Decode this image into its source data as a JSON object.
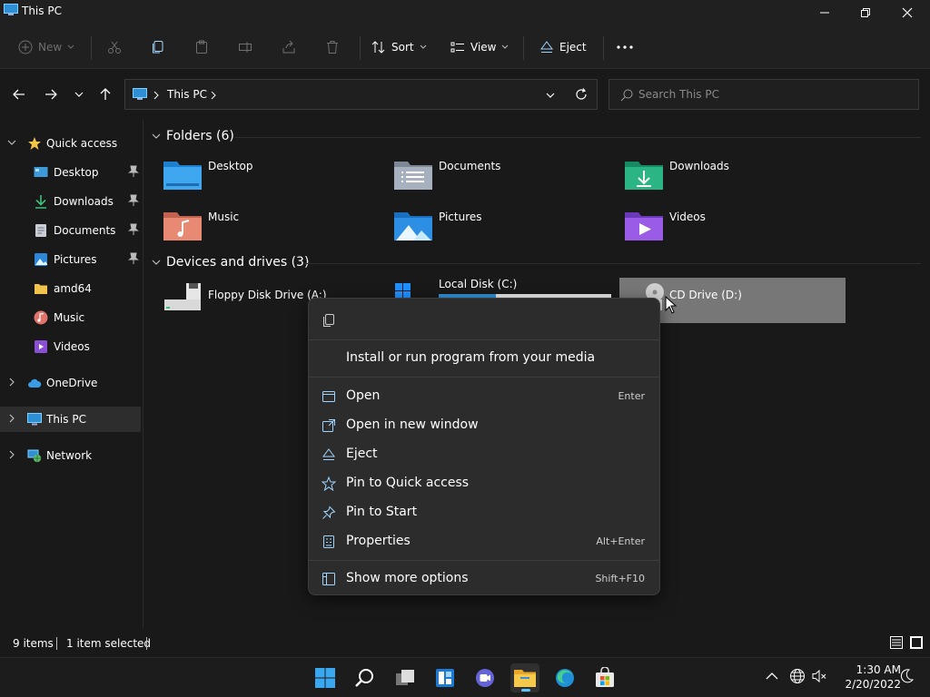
{
  "window": {
    "title": "This PC"
  },
  "toolbar": {
    "new_label": "New",
    "sort_label": "Sort",
    "view_label": "View",
    "eject_label": "Eject"
  },
  "address": {
    "crumb": "This PC",
    "search_placeholder": "Search This PC"
  },
  "nav": {
    "quick_access": "Quick access",
    "items": [
      {
        "label": "Desktop"
      },
      {
        "label": "Downloads"
      },
      {
        "label": "Documents"
      },
      {
        "label": "Pictures"
      },
      {
        "label": "amd64"
      },
      {
        "label": "Music"
      },
      {
        "label": "Videos"
      }
    ],
    "onedrive": "OneDrive",
    "thispc": "This PC",
    "network": "Network"
  },
  "content": {
    "folders_header": "Folders (6)",
    "folders": [
      {
        "label": "Desktop"
      },
      {
        "label": "Documents"
      },
      {
        "label": "Downloads"
      },
      {
        "label": "Music"
      },
      {
        "label": "Pictures"
      },
      {
        "label": "Videos"
      }
    ],
    "drives_header": "Devices and drives (3)",
    "drives": [
      {
        "label": "Floppy Disk Drive (A:)"
      },
      {
        "label": "Local Disk (C:)",
        "usage": 0.33
      },
      {
        "label": "CD Drive (D:)"
      }
    ]
  },
  "context_menu": {
    "autoplay": "Install or run program from your media",
    "items": [
      {
        "label": "Open",
        "shortcut": "Enter"
      },
      {
        "label": "Open in new window",
        "shortcut": ""
      },
      {
        "label": "Eject",
        "shortcut": ""
      },
      {
        "label": "Pin to Quick access",
        "shortcut": ""
      },
      {
        "label": "Pin to Start",
        "shortcut": ""
      },
      {
        "label": "Properties",
        "shortcut": "Alt+Enter"
      }
    ],
    "more": {
      "label": "Show more options",
      "shortcut": "Shift+F10"
    }
  },
  "status": {
    "items_count": "9 items",
    "selected": "1 item selected"
  },
  "taskbar": {
    "time": "1:30 AM",
    "date": "2/20/2022"
  },
  "colors": {
    "accent": "#5ec2ff",
    "folder_yellow": "#f0c44c",
    "menu_bg": "#2c2c2c"
  }
}
